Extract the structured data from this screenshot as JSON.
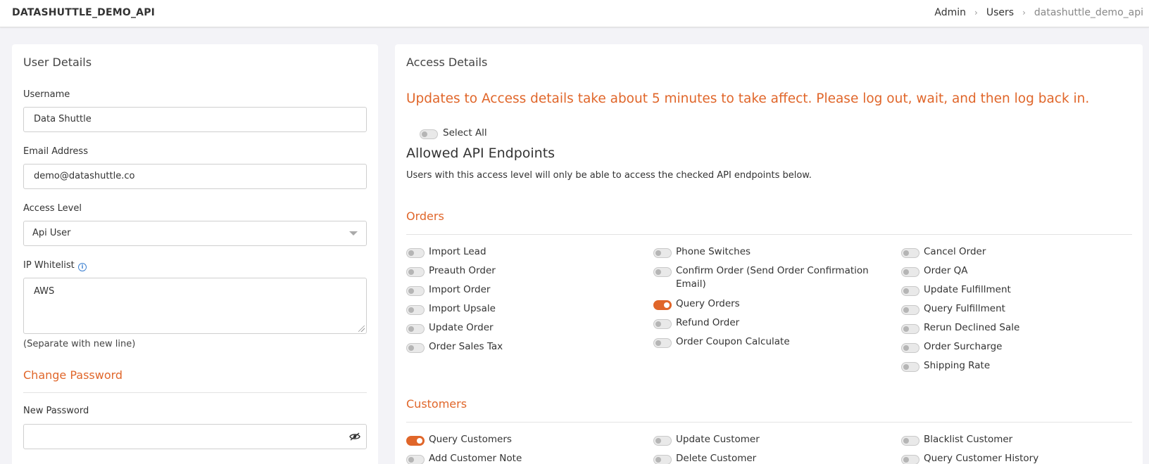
{
  "header": {
    "app_title": "DATASHUTTLE_DEMO_API",
    "breadcrumb": [
      "Admin",
      "Users",
      "datashuttle_demo_api"
    ]
  },
  "user_details": {
    "title": "User Details",
    "username": {
      "label": "Username",
      "value": "Data Shuttle"
    },
    "email": {
      "label": "Email Address",
      "value": "demo@datashuttle.co"
    },
    "access_level": {
      "label": "Access Level",
      "value": "Api User"
    },
    "ip_whitelist": {
      "label": "IP Whitelist",
      "value": "AWS",
      "helper": "(Separate with new line)"
    },
    "change_password": {
      "title": "Change Password",
      "new_password_label": "New Password",
      "new_password_value": ""
    }
  },
  "access_details": {
    "title": "Access Details",
    "notice": "Updates to Access details take about 5 minutes to take affect. Please log out, wait, and then log back in.",
    "select_all": {
      "label": "Select All",
      "checked": false
    },
    "endpoints_title": "Allowed API Endpoints",
    "endpoints_desc": "Users with this access level will only be able to access the checked API endpoints below.",
    "orders": {
      "title": "Orders",
      "col1": [
        {
          "label": "Import Lead",
          "checked": false
        },
        {
          "label": "Preauth Order",
          "checked": false
        },
        {
          "label": "Import Order",
          "checked": false
        },
        {
          "label": "Import Upsale",
          "checked": false
        },
        {
          "label": "Update Order",
          "checked": false
        },
        {
          "label": "Order Sales Tax",
          "checked": false
        }
      ],
      "col2": [
        {
          "label": "Phone Switches",
          "checked": false
        },
        {
          "label": "Confirm Order (Send Order Confirmation Email)",
          "checked": false
        },
        {
          "label": "Query Orders",
          "checked": true
        },
        {
          "label": "Refund Order",
          "checked": false
        },
        {
          "label": "Order Coupon Calculate",
          "checked": false
        }
      ],
      "col3": [
        {
          "label": "Cancel Order",
          "checked": false
        },
        {
          "label": "Order QA",
          "checked": false
        },
        {
          "label": "Update Fulfillment",
          "checked": false
        },
        {
          "label": "Query Fulfillment",
          "checked": false
        },
        {
          "label": "Rerun Declined Sale",
          "checked": false
        },
        {
          "label": "Order Surcharge",
          "checked": false
        },
        {
          "label": "Shipping Rate",
          "checked": false
        }
      ]
    },
    "customers": {
      "title": "Customers",
      "col1": [
        {
          "label": "Query Customers",
          "checked": true
        },
        {
          "label": "Add Customer Note",
          "checked": false
        }
      ],
      "col2": [
        {
          "label": "Update Customer",
          "checked": false
        },
        {
          "label": "Delete Customer",
          "checked": false
        }
      ],
      "col3": [
        {
          "label": "Blacklist Customer",
          "checked": false
        },
        {
          "label": "Query Customer History",
          "checked": false
        }
      ]
    }
  },
  "colors": {
    "accent": "#e0662a",
    "info": "#3a7fd0",
    "background": "#f3f3f7"
  },
  "icons": [
    "info-icon",
    "eye-slash-icon",
    "chevron-right-icon",
    "chevron-down-icon"
  ]
}
